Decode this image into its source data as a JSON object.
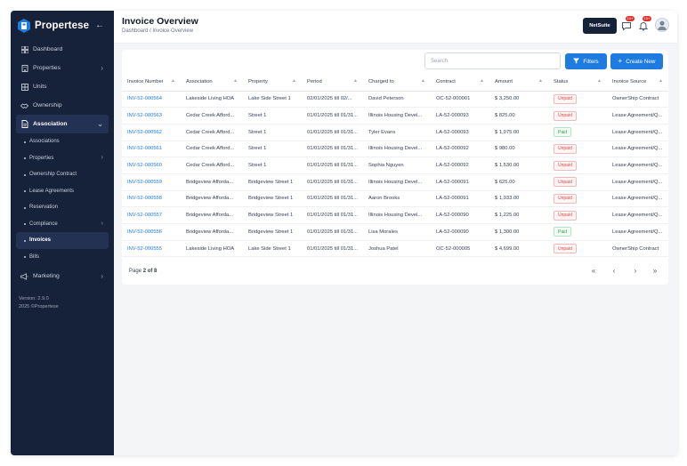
{
  "brand": {
    "name": "Propertese"
  },
  "sidebar": {
    "items": [
      {
        "label": "Dashboard",
        "icon": "dashboard-icon"
      },
      {
        "label": "Properties",
        "icon": "building-icon",
        "has_children": true
      },
      {
        "label": "Units",
        "icon": "units-icon"
      },
      {
        "label": "Ownership",
        "icon": "handshake-icon"
      },
      {
        "label": "Association",
        "icon": "document-icon",
        "expanded": true
      }
    ],
    "sub_items": [
      {
        "label": "Associations"
      },
      {
        "label": "Properties",
        "has_children": true
      },
      {
        "label": "Ownership Contract"
      },
      {
        "label": "Lease Agreements"
      },
      {
        "label": "Reservation"
      },
      {
        "label": "Compliance",
        "has_children": true
      },
      {
        "label": "Invoices",
        "active": true
      },
      {
        "label": "Bills"
      }
    ],
    "marketing": {
      "label": "Marketing",
      "icon": "megaphone-icon"
    },
    "version": "Version: 2.9.0",
    "copyright": "2025 ©Propertese"
  },
  "header": {
    "title": "Invoice Overview",
    "breadcrumb": "Dashboard / Invoice Overview",
    "netsuite_label": "NetSuite",
    "badge_1": "10+",
    "badge_2": "10+"
  },
  "toolbar": {
    "search_placeholder": "Search",
    "filters_label": "Filters",
    "new_label": "Create New"
  },
  "table": {
    "columns": [
      "Invoice Number",
      "Association",
      "Property",
      "Period",
      "Charged to",
      "Contract",
      "Amount",
      "Status",
      "Invoice Source"
    ],
    "rows": [
      {
        "invoice": "INV-52-000564",
        "association": "Lakeside Living HOA",
        "property": "Lake Side Street 1",
        "period": "02/01/2025 till 02/...",
        "charged_to": "David Peterson",
        "contract": "OC-52-000001",
        "amount": "$ 3,250.00",
        "status": "Unpaid",
        "source": "OwnerShip Contract"
      },
      {
        "invoice": "INV-52-000563",
        "association": "Cedar Creek Afford...",
        "property": "Street 1",
        "period": "01/01/2025 till 01/31...",
        "charged_to": "Illinois Housing Devel...",
        "contract": "LA-52-000093",
        "amount": "$ 825.00",
        "status": "Unpaid",
        "source": "Lease Agreement/Q..."
      },
      {
        "invoice": "INV-52-000562",
        "association": "Cedar Creek Afford...",
        "property": "Street 1",
        "period": "01/01/2025 till 01/31...",
        "charged_to": "Tyler Evans",
        "contract": "LA-52-000093",
        "amount": "$ 1,975.00",
        "status": "Paid",
        "source": "Lease Agreement/Q..."
      },
      {
        "invoice": "INV-52-000561",
        "association": "Cedar Creek Afford...",
        "property": "Street 1",
        "period": "01/01/2025 till 01/31...",
        "charged_to": "Illinois Housing Devel...",
        "contract": "LA-52-000092",
        "amount": "$ 980.00",
        "status": "Unpaid",
        "source": "Lease Agreement/Q..."
      },
      {
        "invoice": "INV-52-000560",
        "association": "Cedar Creek Afford...",
        "property": "Street 1",
        "period": "01/01/2025 till 01/31...",
        "charged_to": "Sophia Nguyen",
        "contract": "LA-52-000092",
        "amount": "$ 1,530.00",
        "status": "Unpaid",
        "source": "Lease Agreement/Q..."
      },
      {
        "invoice": "INV-52-000559",
        "association": "Bridgeview Afforda...",
        "property": "Bridgeview Street 1",
        "period": "01/01/2025 till 01/31...",
        "charged_to": "Illinois Housing Devel...",
        "contract": "LA-52-000091",
        "amount": "$ 625.00",
        "status": "Unpaid",
        "source": "Lease Agreement/Q..."
      },
      {
        "invoice": "INV-52-000558",
        "association": "Bridgeview Afforda...",
        "property": "Bridgeview Street 1",
        "period": "01/01/2025 till 01/31...",
        "charged_to": "Aaron Brooks",
        "contract": "LA-52-000091",
        "amount": "$ 1,933.00",
        "status": "Unpaid",
        "source": "Lease Agreement/Q..."
      },
      {
        "invoice": "INV-52-000557",
        "association": "Bridgeview Afforda...",
        "property": "Bridgeview Street 1",
        "period": "01/01/2025 till 01/31...",
        "charged_to": "Illinois Housing Devel...",
        "contract": "LA-52-000090",
        "amount": "$ 1,225.00",
        "status": "Unpaid",
        "source": "Lease Agreement/Q..."
      },
      {
        "invoice": "INV-52-000556",
        "association": "Bridgeview Afforda...",
        "property": "Bridgeview Street 1",
        "period": "01/01/2025 till 01/31...",
        "charged_to": "Lisa Morales",
        "contract": "LA-52-000090",
        "amount": "$ 1,300.00",
        "status": "Paid",
        "source": "Lease Agreement/Q..."
      },
      {
        "invoice": "INV-52-000555",
        "association": "Lakeside Living HOA",
        "property": "Lake Side Street 1",
        "period": "01/01/2025 till 01/31...",
        "charged_to": "Joshua Patel",
        "contract": "OC-52-000005",
        "amount": "$ 4,699.00",
        "status": "Unpaid",
        "source": "OwnerShip Contract"
      }
    ]
  },
  "pagination": {
    "prefix": "Page ",
    "current": "2 of 8"
  },
  "colors": {
    "sidebar_bg": "#16213a",
    "accent": "#1e7be0",
    "unpaid": "#d64545",
    "paid": "#2f9e58"
  }
}
